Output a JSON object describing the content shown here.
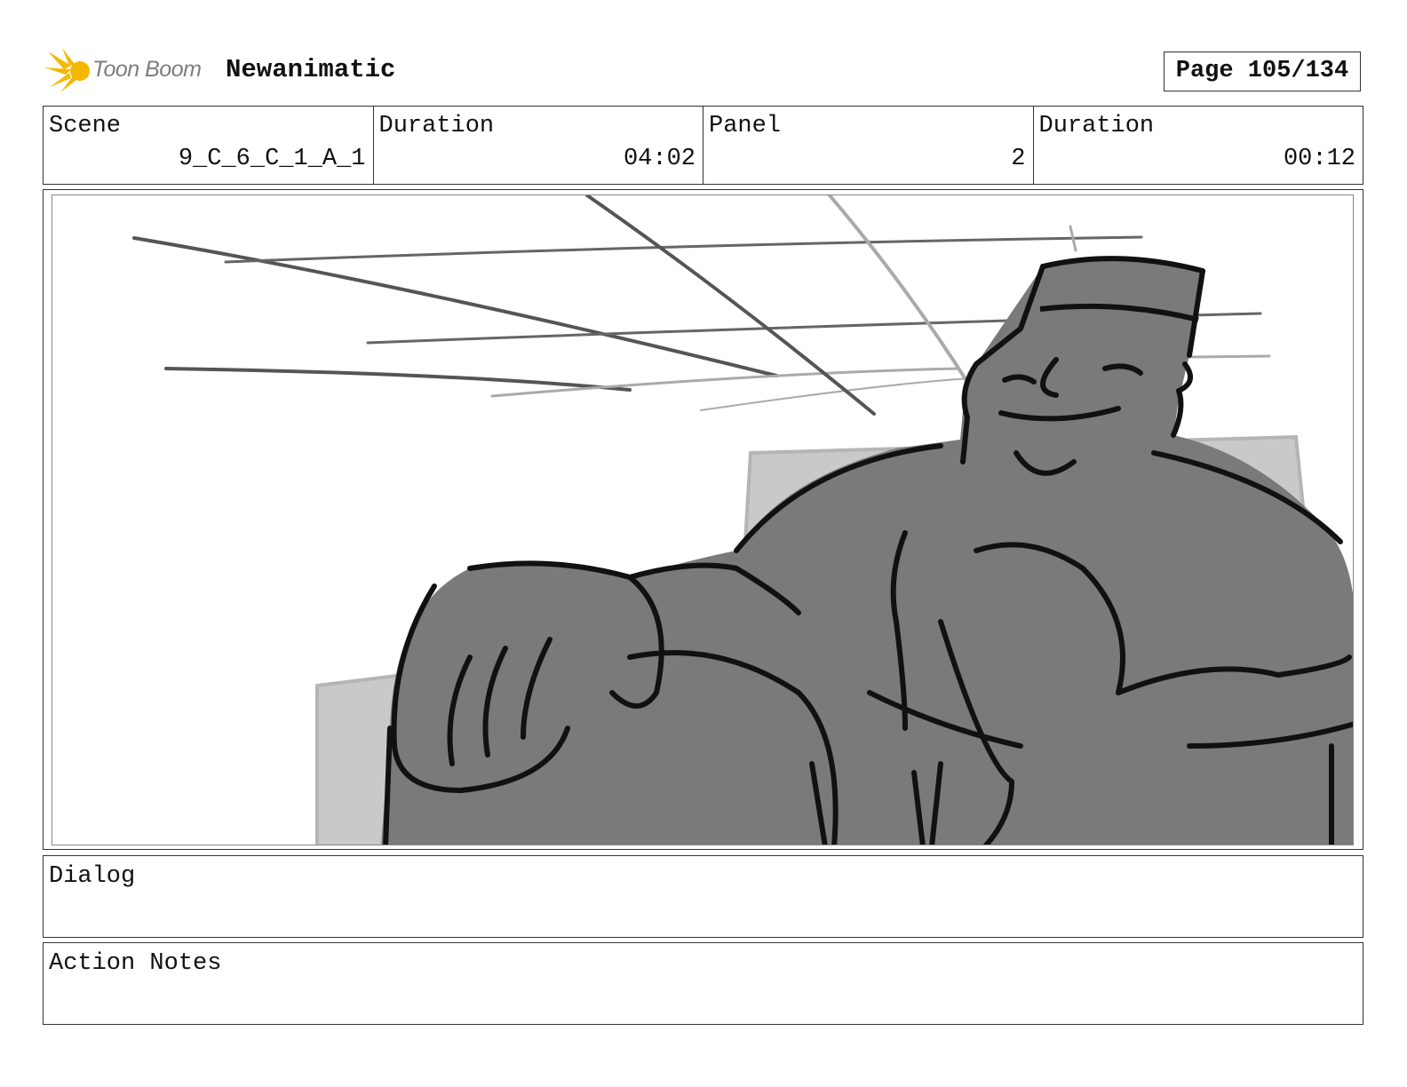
{
  "header": {
    "logo_text": "Toon Boom",
    "project_title": "Newanimatic",
    "page": "Page 105/134"
  },
  "info": {
    "scene_label": "Scene",
    "scene_value": "9_C_6_C_1_A_1",
    "scene_duration_label": "Duration",
    "scene_duration_value": "04:02",
    "panel_label": "Panel",
    "panel_value": "2",
    "panel_duration_label": "Duration",
    "panel_duration_value": "00:12"
  },
  "dialog": {
    "label": "Dialog"
  },
  "action_notes": {
    "label": "Action Notes"
  },
  "colors": {
    "logo_yellow": "#f5b800",
    "sketch_fill": "#7a7a7a",
    "sketch_line": "#111111"
  }
}
